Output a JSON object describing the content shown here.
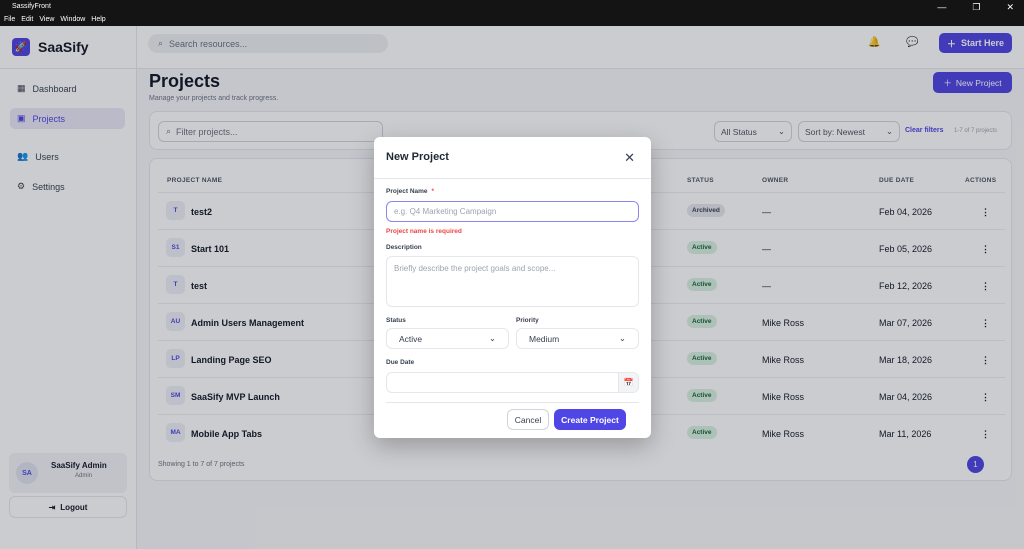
{
  "window": {
    "title": "SassifyFront",
    "menu": [
      "File",
      "Edit",
      "View",
      "Window",
      "Help"
    ]
  },
  "sidebar": {
    "brand": "SaaSify",
    "items": [
      {
        "label": "Dashboard"
      },
      {
        "label": "Projects"
      },
      {
        "label": "Users"
      },
      {
        "label": "Settings"
      }
    ],
    "user": {
      "initials": "SA",
      "name": "SaaSify Admin",
      "role": "Admin"
    },
    "logout": "Logout"
  },
  "header": {
    "search_placeholder": "Search resources...",
    "start_here": "Start Here"
  },
  "page": {
    "title": "Projects",
    "subtitle": "Manage your projects and track progress.",
    "new_project": "New Project"
  },
  "filters": {
    "placeholder": "Filter projects...",
    "status": "All Status",
    "sort": "Sort by: Newest",
    "clear": "Clear filters",
    "count": "1-7 of 7 projects"
  },
  "table": {
    "headers": [
      "PROJECT NAME",
      "STATUS",
      "OWNER",
      "DUE DATE",
      "ACTIONS"
    ],
    "rows": [
      {
        "initials": "T",
        "name": "test2",
        "status": "Archived",
        "owner": "—",
        "due": "Feb 04, 2026"
      },
      {
        "initials": "S1",
        "name": "Start 101",
        "status": "Active",
        "owner": "—",
        "due": "Feb 05, 2026"
      },
      {
        "initials": "T",
        "name": "test",
        "status": "Active",
        "owner": "—",
        "due": "Feb 12, 2026"
      },
      {
        "initials": "AU",
        "name": "Admin Users Management",
        "status": "Active",
        "owner": "Mike Ross",
        "due": "Mar 07, 2026"
      },
      {
        "initials": "LP",
        "name": "Landing Page SEO",
        "status": "Active",
        "owner": "Mike Ross",
        "due": "Mar 18, 2026"
      },
      {
        "initials": "SM",
        "name": "SaaSify MVP Launch",
        "status": "Active",
        "owner": "Mike Ross",
        "due": "Mar 04, 2026"
      },
      {
        "initials": "MA",
        "name": "Mobile App Tabs",
        "status": "Active",
        "owner": "Mike Ross",
        "due": "Mar 11, 2026"
      }
    ],
    "footer": "Showing 1 to 7 of 7 projects",
    "page": "1"
  },
  "modal": {
    "title": "New Project",
    "name_label": "Project Name",
    "required_mark": "*",
    "name_placeholder": "e.g. Q4 Marketing Campaign",
    "error": "Project name is required",
    "desc_label": "Description",
    "desc_placeholder": "Briefly describe the project goals and scope...",
    "status_label": "Status",
    "status_value": "Active",
    "priority_label": "Priority",
    "priority_value": "Medium",
    "due_label": "Due Date",
    "cancel": "Cancel",
    "create": "Create Project"
  }
}
